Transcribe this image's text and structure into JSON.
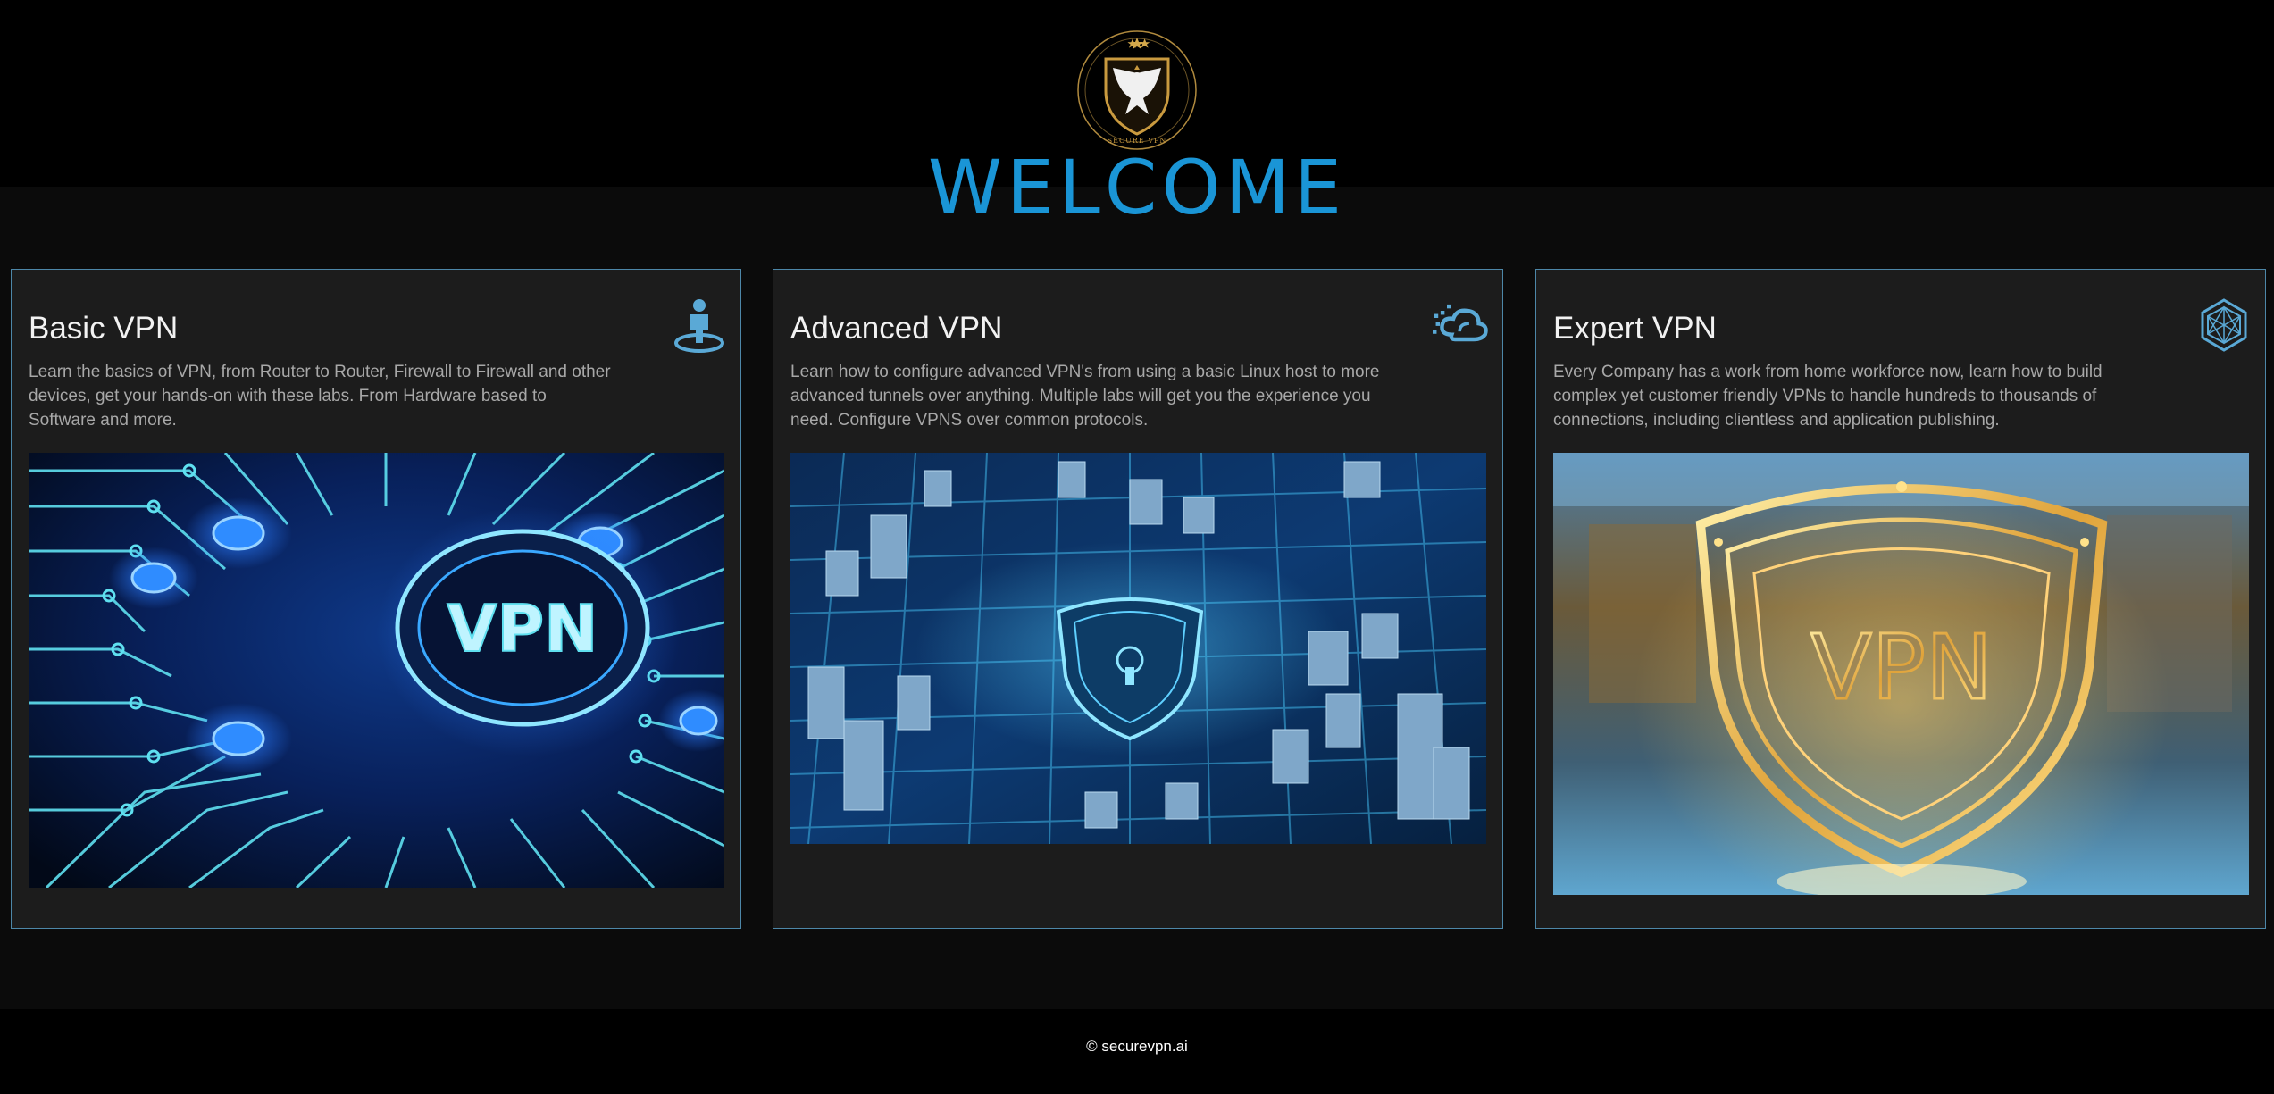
{
  "logo": {
    "name": "secure-vpn-eagle-logo",
    "text": "SECURE VPN"
  },
  "header": {
    "title": "WELCOME"
  },
  "cards": [
    {
      "title": "Basic VPN",
      "description": "Learn the basics of VPN, from Router to Router, Firewall to Firewall and other devices, get your hands-on with these labs. From Hardware based to Software and more.",
      "icon": "user-pin-icon",
      "image_text": "VPN"
    },
    {
      "title": "Advanced VPN",
      "description": "Learn how to configure advanced VPN's from using a basic Linux host to more advanced tunnels over anything. Multiple labs will get you the experience you need. Configure VPNS over common protocols.",
      "icon": "cloud-icon"
    },
    {
      "title": "Expert VPN",
      "description": "Every Company has a work from home workforce now, learn how to build complex yet customer friendly VPNs to handle hundreds to thousands of connections, including clientless and application publishing.",
      "icon": "hexagon-network-icon",
      "image_text": "VPN"
    }
  ],
  "footer": {
    "copyright": "© securevpn.ai"
  },
  "colors": {
    "accent": "#1a95d6",
    "card_border": "#4d87a8",
    "card_bg": "#1c1c1c",
    "icon": "#5aa9d6",
    "gold": "#d4a84b"
  }
}
